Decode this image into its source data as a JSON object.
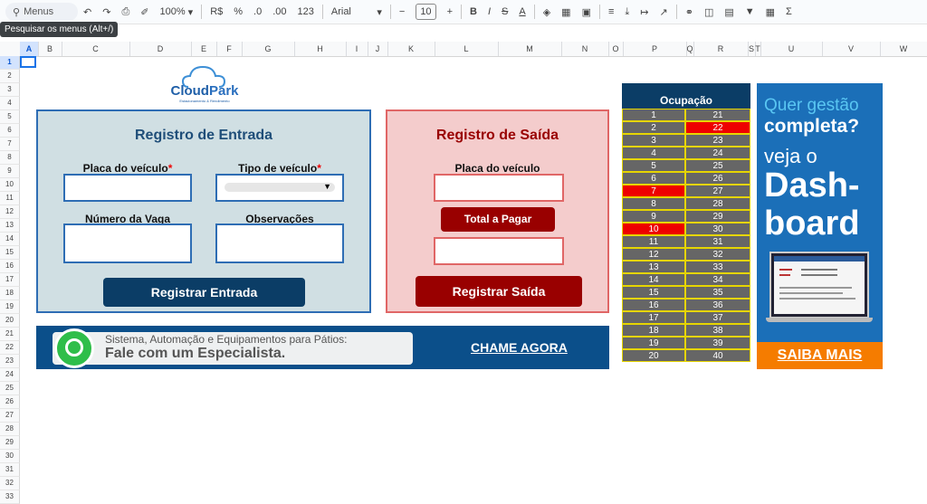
{
  "toolbar": {
    "menus_label": "Menus",
    "zoom": "100%",
    "currency": "R$",
    "percent": "%",
    "dec_less": ".0",
    "dec_more": ".00",
    "num_format": "123",
    "font": "Arial",
    "font_size": "10",
    "minus": "−",
    "plus": "+",
    "bold": "B",
    "italic": "I",
    "strike": "S",
    "underline_a": "A",
    "sum": "Σ",
    "tooltip": "Pesquisar os menus (Alt+/)"
  },
  "columns": [
    "A",
    "B",
    "C",
    "D",
    "E",
    "F",
    "G",
    "H",
    "I",
    "J",
    "K",
    "L",
    "M",
    "N",
    "O",
    "P",
    "Q",
    "R",
    "S",
    "T",
    "U",
    "V",
    "W"
  ],
  "rows": [
    "1",
    "2",
    "3",
    "4",
    "5",
    "6",
    "7",
    "8",
    "9",
    "10",
    "11",
    "12",
    "13",
    "14",
    "15",
    "16",
    "17",
    "18",
    "19",
    "20",
    "21",
    "22",
    "23",
    "24",
    "25",
    "26",
    "27",
    "28",
    "29",
    "30",
    "31",
    "32",
    "33"
  ],
  "logo": {
    "cloud": "Cloud",
    "park": "Park",
    "sub": "Estacionamento & Rendimento"
  },
  "entrada": {
    "title": "Registro de Entrada",
    "placa_label": "Placa do veículo",
    "tipo_label": "Tipo de veículo",
    "required_mark": "*",
    "vaga_label": "Número da Vaga",
    "obs_label": "Observações",
    "button": "Registrar Entrada",
    "title_color": "#1f4e79",
    "button_color": "#0b3d66"
  },
  "saida": {
    "title": "Registro de Saída",
    "placa_label": "Placa do veículo",
    "total_button": "Total a Pagar",
    "button": "Registrar Saída",
    "title_color": "#990000",
    "button_color": "#990000"
  },
  "banner": {
    "line1": "Sistema, Automação e Equipamentos para Pátios:",
    "line2": "Fale com um Especialista.",
    "cta": "CHAME AGORA"
  },
  "ocupacao": {
    "title": "Ocupação",
    "left": [
      "1",
      "2",
      "3",
      "4",
      "5",
      "6",
      "7",
      "8",
      "9",
      "10",
      "11",
      "12",
      "13",
      "14",
      "15",
      "16",
      "17",
      "18",
      "19",
      "20"
    ],
    "right": [
      "21",
      "22",
      "23",
      "24",
      "25",
      "26",
      "27",
      "28",
      "29",
      "30",
      "31",
      "32",
      "33",
      "34",
      "35",
      "36",
      "37",
      "38",
      "39",
      "40"
    ],
    "occupied": [
      "22",
      "7",
      "10"
    ]
  },
  "ad": {
    "line1": "Quer gestão",
    "line2": "completa?",
    "line3": "veja o",
    "line4": "Dash-",
    "line5": "board",
    "button": "SAIBA MAIS"
  }
}
